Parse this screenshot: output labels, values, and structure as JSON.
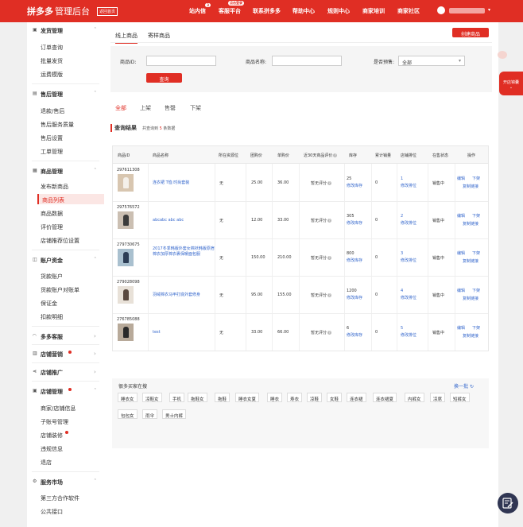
{
  "header": {
    "logo_brand": "拼多多",
    "logo_sub": "管理后台",
    "back_label": "返回首页",
    "nav": [
      {
        "label": "站内信",
        "badge": "3"
      },
      {
        "label": "客服平台",
        "tip": "点击登录"
      },
      {
        "label": "联系拼多多"
      },
      {
        "label": "帮助中心"
      },
      {
        "label": "规则中心"
      },
      {
        "label": "商家培训"
      },
      {
        "label": "商家社区"
      }
    ]
  },
  "sidebar": {
    "groups": [
      {
        "label": "发货管理",
        "icon": "box-icon",
        "items": [
          "订单查询",
          "批量发货",
          "运费模版"
        ]
      },
      {
        "label": "售后管理",
        "icon": "aftersale-icon",
        "items": [
          "退款/售后",
          "售后服务质量",
          "售后设置",
          "工单管理"
        ]
      },
      {
        "label": "商品管理",
        "icon": "goods-icon",
        "items": [
          "发布新商品",
          "商品列表",
          "商品数据",
          "评价管理",
          "店铺推荐位设置"
        ]
      },
      {
        "label": "账户资金",
        "icon": "wallet-icon",
        "items": [
          "货款账户",
          "货款账户对账单",
          "保证金",
          "扣款明细"
        ]
      },
      {
        "label": "多多客服",
        "icon": "headset-icon",
        "items": []
      },
      {
        "label": "店铺营销",
        "icon": "marketing-icon",
        "items": []
      },
      {
        "label": "店铺推广",
        "icon": "promote-icon",
        "items": []
      },
      {
        "label": "店铺管理",
        "icon": "store-icon",
        "items": [
          "商家/店铺信息",
          "子账号管理",
          "店铺装修",
          "违规信息",
          "退店"
        ]
      },
      {
        "label": "服务市场",
        "icon": "service-icon",
        "items": [
          "第三方合作软件",
          "公共接口"
        ]
      }
    ]
  },
  "tabs": [
    "线上商品",
    "寄样商品"
  ],
  "create_button": "创建商品",
  "filters": {
    "id_label": "商品ID:",
    "name_label": "商品名称:",
    "presale_label": "是否预售:",
    "presale_value": "全部",
    "query_button": "查询"
  },
  "status_tabs": [
    "全部",
    "上架",
    "售罄",
    "下架"
  ],
  "result": {
    "title": "查询结果",
    "count_prefix": "共查询到",
    "count": "5",
    "count_suffix": "条数据"
  },
  "table": {
    "headers": [
      "商品ID",
      "商品名称",
      "所在资源位",
      "团购价",
      "单购价",
      "近30天商品评价",
      "库存",
      "累计销量",
      "店铺排位",
      "在售状态",
      "操作"
    ],
    "rows": [
      {
        "id": "297611308",
        "name": "连衣裙 T恤 时尚套装",
        "resource": "无",
        "group_price": "25.00",
        "single_price": "36.00",
        "rating": "暂无评分",
        "stock": "25",
        "stock_action": "修改库存",
        "sales": "0",
        "rank": "1",
        "rank_action": "修改排位",
        "status": "销售中"
      },
      {
        "id": "297576572",
        "name": "abcabc abc abc",
        "resource": "无",
        "group_price": "12.00",
        "single_price": "33.00",
        "rating": "暂无评分",
        "stock": "305",
        "stock_action": "修改库存",
        "sales": "0",
        "rank": "2",
        "rank_action": "修改排位",
        "status": "销售中"
      },
      {
        "id": "279730675",
        "name": "2017冬季韩版外套女棉袄韩版原宿棉衣加厚棉衣裹保暖面包服",
        "resource": "无",
        "group_price": "150.00",
        "single_price": "210.00",
        "rating": "暂无评分",
        "stock": "800",
        "stock_action": "修改库存",
        "sales": "0",
        "rank": "3",
        "rank_action": "修改排位",
        "status": "销售中"
      },
      {
        "id": "279028098",
        "name": "羽绒棉衣马甲打底外套修身",
        "resource": "无",
        "group_price": "95.00",
        "single_price": "155.00",
        "rating": "暂无评分",
        "stock": "1200",
        "stock_action": "修改库存",
        "sales": "0",
        "rank": "4",
        "rank_action": "修改排位",
        "status": "销售中"
      },
      {
        "id": "276785088",
        "name": "test",
        "resource": "无",
        "group_price": "33.00",
        "single_price": "66.00",
        "rating": "暂无评分",
        "stock": "6",
        "stock_action": "修改库存",
        "sales": "0",
        "rank": "5",
        "rank_action": "修改排位",
        "status": "销售中"
      }
    ],
    "actions": {
      "edit": "编辑",
      "offline": "下架",
      "copy": "复制链接"
    }
  },
  "hot": {
    "title": "很多买家在搜",
    "refresh": "换一批",
    "keywords": [
      "睡衣女",
      "凉鞋女",
      "手机",
      "拖鞋女",
      "拖鞋",
      "睡衣女夏",
      "睡衣",
      "寿衣",
      "凉鞋",
      "女鞋",
      "连衣裙",
      "连衣裙夏",
      "内裤女",
      "凉席",
      "短裤女",
      "包包女",
      "雨伞",
      "男士内裤"
    ]
  },
  "float_banner": "开店锦囊",
  "colors": {
    "brand": "#e02e24",
    "link": "#3366cc"
  }
}
